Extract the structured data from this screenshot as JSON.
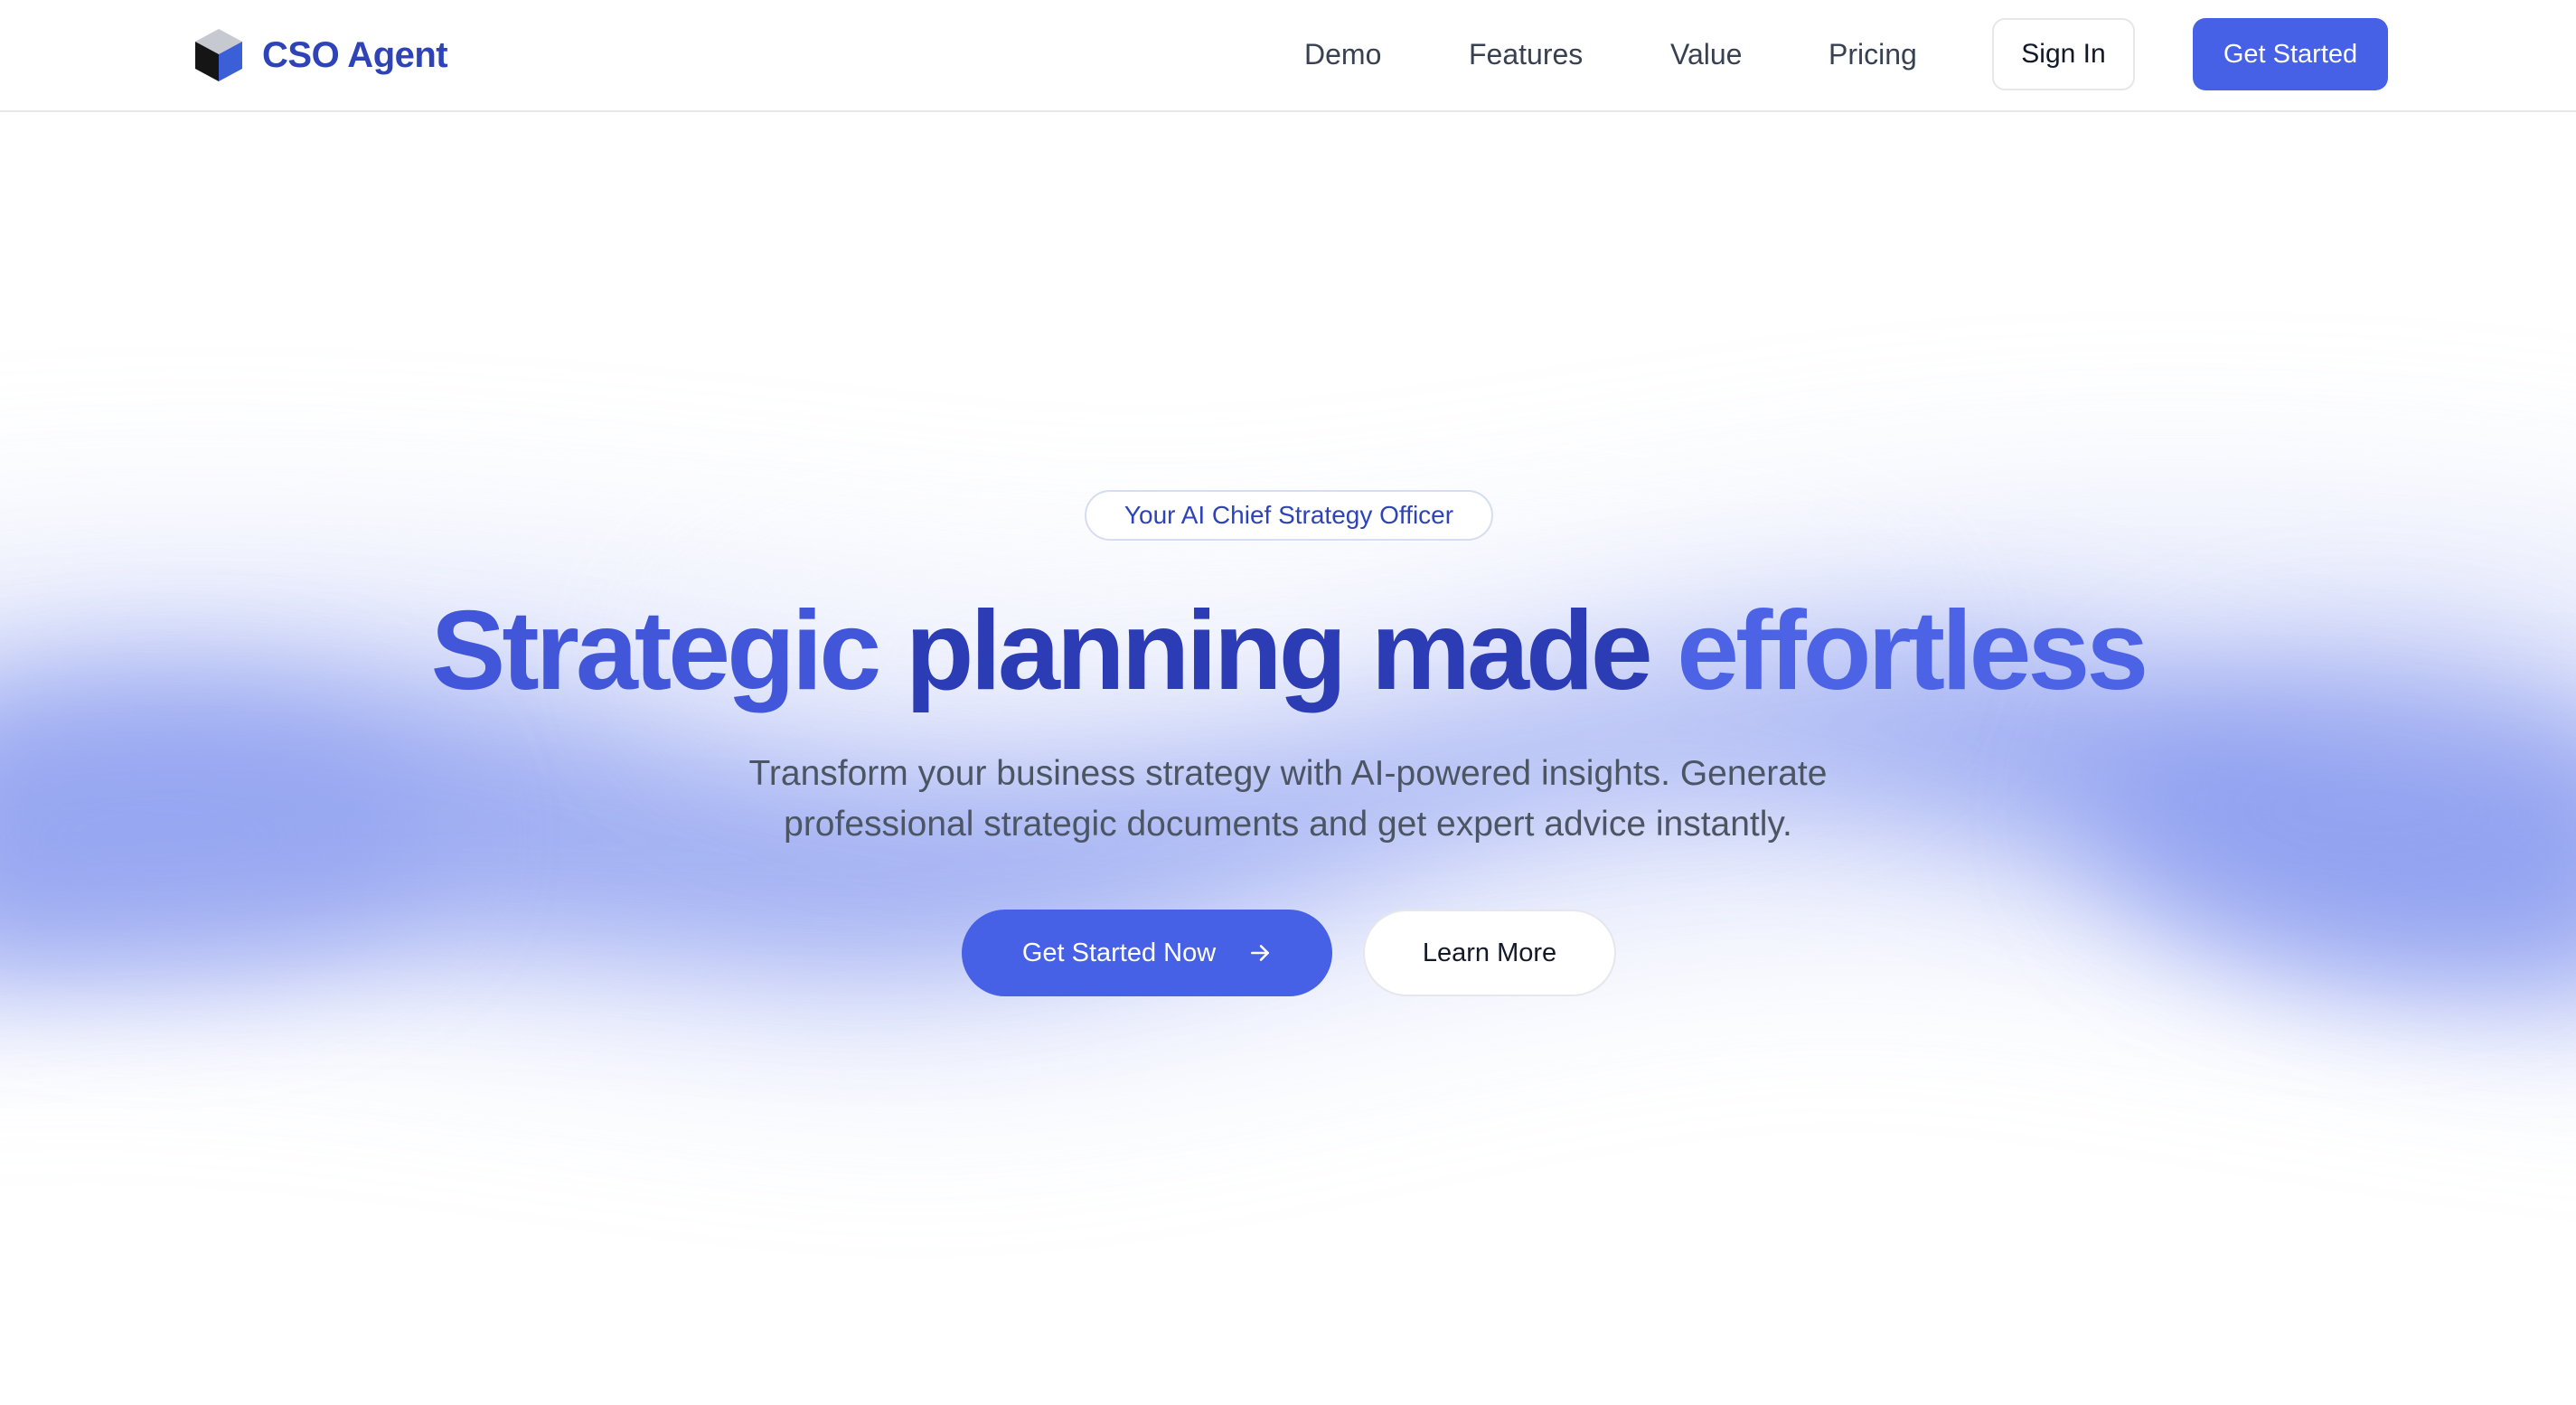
{
  "brand": {
    "name": "CSO Agent",
    "logo_icon": "cube-logo-icon"
  },
  "nav": {
    "links": [
      "Demo",
      "Features",
      "Value",
      "Pricing"
    ],
    "sign_in_label": "Sign In",
    "get_started_label": "Get Started"
  },
  "hero": {
    "badge": "Your AI Chief Strategy Officer",
    "headline": {
      "part1": "Strategic ",
      "part2": "planning made ",
      "part3": "effortless"
    },
    "subtitle_line1": "Transform your business strategy with AI-powered insights. Generate",
    "subtitle_line2": "professional strategic documents and get expert advice instantly.",
    "primary_cta": "Get Started Now",
    "primary_cta_icon": "arrow-right-icon",
    "secondary_cta": "Learn More"
  },
  "colors": {
    "accent": "#4660e6",
    "brand_text": "#2f43b8",
    "glow": "#8a9cf0"
  }
}
